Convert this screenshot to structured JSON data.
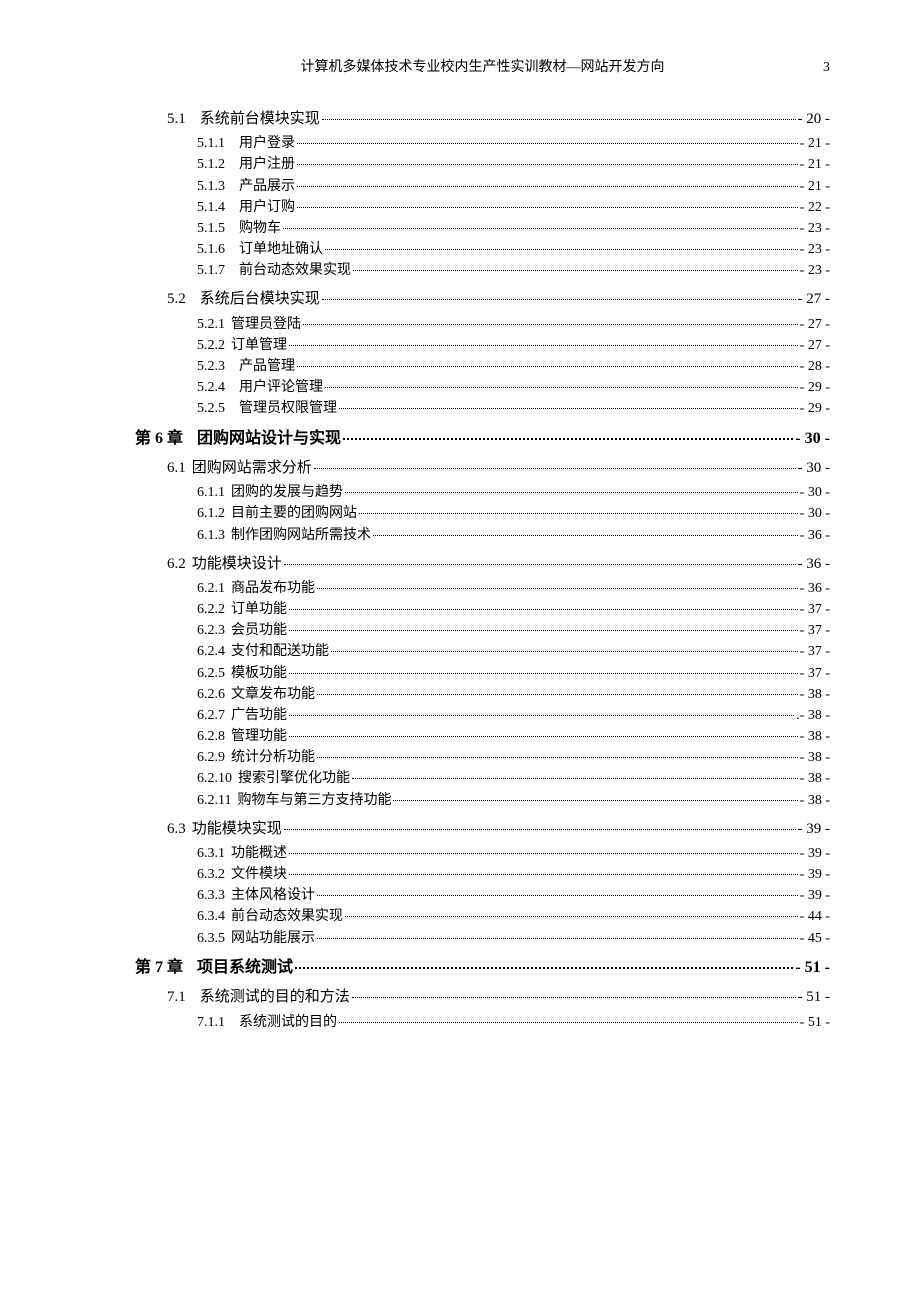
{
  "header": {
    "title": "计算机多媒体技术专业校内生产性实训教材—网站开发方向",
    "page_number": "3"
  },
  "toc": [
    {
      "level": "section",
      "num": "5.1",
      "gap": "md",
      "title": "系统前台模块实现",
      "page": "- 20 -"
    },
    {
      "level": "sub",
      "num": "5.1.1",
      "gap": "md",
      "title": "用户登录",
      "page": "- 21 -"
    },
    {
      "level": "sub",
      "num": "5.1.2",
      "gap": "md",
      "title": "用户注册",
      "page": "- 21 -"
    },
    {
      "level": "sub",
      "num": "5.1.3",
      "gap": "md",
      "title": "产品展示",
      "page": "- 21 -"
    },
    {
      "level": "sub",
      "num": "5.1.4",
      "gap": "md",
      "title": "用户订购",
      "page": "- 22 -"
    },
    {
      "level": "sub",
      "num": "5.1.5",
      "gap": "md",
      "title": "购物车",
      "page": "- 23 -"
    },
    {
      "level": "sub",
      "num": "5.1.6",
      "gap": "md",
      "title": "订单地址确认",
      "page": "- 23 -"
    },
    {
      "level": "sub",
      "num": "5.1.7",
      "gap": "md",
      "title": "前台动态效果实现",
      "page": "- 23 -"
    },
    {
      "level": "section",
      "num": "5.2",
      "gap": "md",
      "title": "系统后台模块实现",
      "page": "- 27 -"
    },
    {
      "level": "sub",
      "num": "5.2.1",
      "gap": "sm",
      "title": "管理员登陆",
      "page": "- 27 -"
    },
    {
      "level": "sub",
      "num": "5.2.2",
      "gap": "sm",
      "title": "订单管理",
      "page": "- 27 -"
    },
    {
      "level": "sub",
      "num": "5.2.3",
      "gap": "md",
      "title": "产品管理",
      "page": "- 28 -"
    },
    {
      "level": "sub",
      "num": "5.2.4",
      "gap": "md",
      "title": "用户评论管理",
      "page": "- 29 -"
    },
    {
      "level": "sub",
      "num": "5.2.5",
      "gap": "md",
      "title": "管理员权限管理",
      "page": "- 29 -"
    },
    {
      "level": "chapter",
      "num": "第 6 章",
      "gap": "md",
      "title": "团购网站设计与实现",
      "page": "- 30 -"
    },
    {
      "level": "section",
      "num": "6.1",
      "gap": "sm",
      "title": "团购网站需求分析",
      "page": "- 30 -"
    },
    {
      "level": "sub",
      "num": "6.1.1",
      "gap": "sm",
      "title": "团购的发展与趋势",
      "page": "- 30 -"
    },
    {
      "level": "sub",
      "num": "6.1.2",
      "gap": "sm",
      "title": "目前主要的团购网站",
      "page": "- 30 -"
    },
    {
      "level": "sub",
      "num": "6.1.3",
      "gap": "sm",
      "title": "制作团购网站所需技术",
      "page": "- 36 -"
    },
    {
      "level": "section",
      "num": "6.2",
      "gap": "sm",
      "title": "功能模块设计",
      "page": "- 36 -"
    },
    {
      "level": "sub",
      "num": "6.2.1",
      "gap": "sm",
      "title": "商品发布功能",
      "page": "- 36 -"
    },
    {
      "level": "sub",
      "num": "6.2.2",
      "gap": "sm",
      "title": "订单功能",
      "page": "- 37 -"
    },
    {
      "level": "sub",
      "num": "6.2.3",
      "gap": "sm",
      "title": "会员功能",
      "page": "- 37 -"
    },
    {
      "level": "sub",
      "num": "6.2.4",
      "gap": "sm",
      "title": "支付和配送功能",
      "page": "- 37 -"
    },
    {
      "level": "sub",
      "num": "6.2.5",
      "gap": "sm",
      "title": "模板功能",
      "page": "- 37 -"
    },
    {
      "level": "sub",
      "num": "6.2.6",
      "gap": "sm",
      "title": "文章发布功能",
      "page": "- 38 -"
    },
    {
      "level": "sub",
      "num": "6.2.7",
      "gap": "sm",
      "title": "广告功能",
      "page": ".- 38 -"
    },
    {
      "level": "sub",
      "num": "6.2.8",
      "gap": "sm",
      "title": "管理功能",
      "page": "- 38 -"
    },
    {
      "level": "sub",
      "num": "6.2.9",
      "gap": "sm",
      "title": "统计分析功能",
      "page": "- 38 -"
    },
    {
      "level": "sub",
      "num": "6.2.10",
      "gap": "sm",
      "title": "搜索引擎优化功能",
      "page": "- 38 -"
    },
    {
      "level": "sub",
      "num": "6.2.11",
      "gap": "sm",
      "title": "购物车与第三方支持功能",
      "page": "- 38 -"
    },
    {
      "level": "section",
      "num": "6.3",
      "gap": "sm",
      "title": "功能模块实现",
      "page": "- 39 -"
    },
    {
      "level": "sub",
      "num": "6.3.1",
      "gap": "sm",
      "title": "功能概述",
      "page": "- 39 -"
    },
    {
      "level": "sub",
      "num": "6.3.2",
      "gap": "sm",
      "title": "文件模块",
      "page": "- 39 -"
    },
    {
      "level": "sub",
      "num": "6.3.3",
      "gap": "sm",
      "title": "主体风格设计",
      "page": "- 39 -"
    },
    {
      "level": "sub",
      "num": "6.3.4",
      "gap": "sm",
      "title": "前台动态效果实现",
      "page": "- 44 -"
    },
    {
      "level": "sub",
      "num": "6.3.5",
      "gap": "sm",
      "title": "网站功能展示",
      "page": "- 45 -"
    },
    {
      "level": "chapter",
      "num": "第 7 章",
      "gap": "md",
      "title": "项目系统测试",
      "page": "- 51 -"
    },
    {
      "level": "section",
      "num": "7.1",
      "gap": "md",
      "title": "系统测试的目的和方法",
      "page": "- 51 -"
    },
    {
      "level": "sub",
      "num": "7.1.1",
      "gap": "md",
      "title": "系统测试的目的",
      "page": "- 51 -"
    }
  ]
}
